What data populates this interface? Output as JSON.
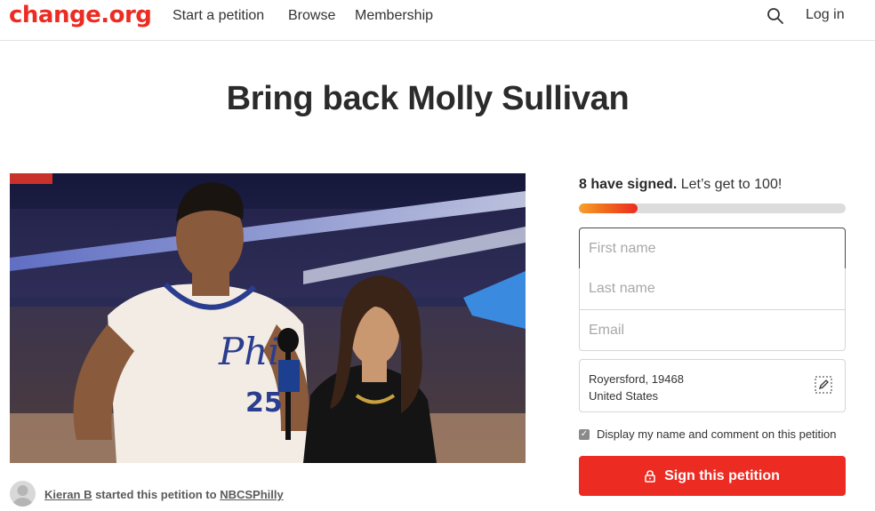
{
  "header": {
    "logo": "change.org",
    "nav": [
      "Start a petition",
      "Browse",
      "Membership"
    ],
    "search_icon": "search-icon",
    "login": "Log in"
  },
  "petition": {
    "title": "Bring back Molly Sullivan",
    "author": "Kieran B",
    "started_text": " started this petition to ",
    "target": "NBCSPhilly"
  },
  "signatures": {
    "count_text": "8 have signed.",
    "goal_text": " Let’s get to 100!",
    "count": 8,
    "goal": 100,
    "progress_fraction": 0.22
  },
  "form": {
    "first_name_placeholder": "First name",
    "last_name_placeholder": "Last name",
    "email_placeholder": "Email",
    "location_line1": "Royersford, 19468",
    "location_line2": "United States",
    "display_checkbox_label": "Display my name and comment on this petition",
    "display_checked": true,
    "sign_button": "Sign this petition"
  },
  "colors": {
    "brand": "#ec2c22",
    "progress_start": "#f7a12c",
    "progress_end": "#ec2c22"
  }
}
